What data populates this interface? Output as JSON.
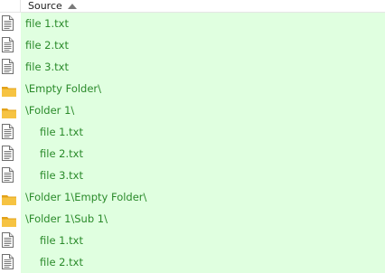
{
  "header": {
    "column_source": "Source",
    "sort": "ascending"
  },
  "colors": {
    "row_background": "#e0ffe0",
    "text": "#2a8a2a",
    "folder": "#f6c342"
  },
  "rows": [
    {
      "type": "file",
      "indent": 0,
      "label": "file 1.txt"
    },
    {
      "type": "file",
      "indent": 0,
      "label": "file 2.txt"
    },
    {
      "type": "file",
      "indent": 0,
      "label": "file 3.txt"
    },
    {
      "type": "folder",
      "indent": 0,
      "label": "\\Empty Folder\\"
    },
    {
      "type": "folder",
      "indent": 0,
      "label": "\\Folder 1\\"
    },
    {
      "type": "file",
      "indent": 1,
      "label": "file 1.txt"
    },
    {
      "type": "file",
      "indent": 1,
      "label": "file 2.txt"
    },
    {
      "type": "file",
      "indent": 1,
      "label": "file 3.txt"
    },
    {
      "type": "folder",
      "indent": 0,
      "label": "\\Folder 1\\Empty Folder\\"
    },
    {
      "type": "folder",
      "indent": 0,
      "label": "\\Folder 1\\Sub 1\\"
    },
    {
      "type": "file",
      "indent": 1,
      "label": "file 1.txt"
    },
    {
      "type": "file",
      "indent": 1,
      "label": "file 2.txt"
    }
  ]
}
